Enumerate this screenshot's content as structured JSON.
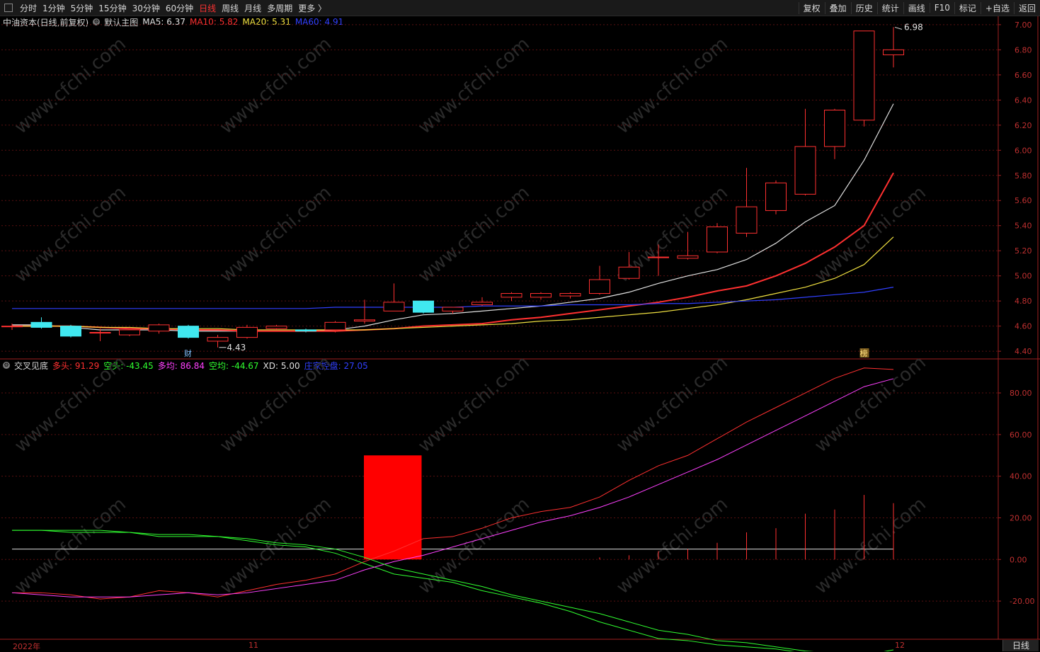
{
  "toolbar": {
    "left_items": [
      "分时",
      "1分钟",
      "5分钟",
      "15分钟",
      "30分钟",
      "60分钟",
      "日线",
      "周线",
      "月线",
      "多周期",
      "更多 〉"
    ],
    "active_item": "日线",
    "right_items": [
      "复权",
      "叠加",
      "历史",
      "统计",
      "画线",
      "F10",
      "标记",
      "+自选",
      "返回"
    ]
  },
  "main_legend": {
    "stock": "中油资本(日线,前复权)",
    "template": "默认主图",
    "ma": [
      {
        "label": "MA5:",
        "value": "6.37",
        "color": "#e0e0e0"
      },
      {
        "label": "MA10:",
        "value": "5.82",
        "color": "#ff3030"
      },
      {
        "label": "MA20:",
        "value": "5.31",
        "color": "#f0e040"
      },
      {
        "label": "MA60:",
        "value": "4.91",
        "color": "#3040ff"
      }
    ]
  },
  "sub_legend": {
    "name": "交叉见底",
    "items": [
      {
        "label": "多头:",
        "value": "91.29",
        "color": "#ff3030"
      },
      {
        "label": "空头:",
        "value": "-43.45",
        "color": "#30ff30"
      },
      {
        "label": "多均:",
        "value": "86.84",
        "color": "#ff40ff"
      },
      {
        "label": "空均:",
        "value": "-44.67",
        "color": "#30ff30"
      },
      {
        "label": "XD:",
        "value": "5.00",
        "color": "#e0e0e0"
      },
      {
        "label": "庄家控盘:",
        "value": "27.05",
        "color": "#3040ff"
      }
    ]
  },
  "annotations": {
    "high": "6.98",
    "low": "4.43",
    "cai": "财",
    "bang": "榜"
  },
  "watermark": "www.cfchi.com",
  "x_axis": {
    "labels": [
      "2022年",
      "11",
      "12"
    ]
  },
  "period_tag": "日线",
  "chart_data": [
    {
      "type": "candlestick",
      "title": "中油资本(日线,前复权)",
      "y_ticks": [
        "7.00",
        "6.80",
        "6.60",
        "6.40",
        "6.20",
        "6.00",
        "5.80",
        "5.60",
        "5.40",
        "5.20",
        "5.00",
        "4.80",
        "4.60",
        "4.40"
      ],
      "ylim": [
        4.35,
        7.05
      ],
      "candles": [
        {
          "o": 4.6,
          "h": 4.62,
          "l": 4.57,
          "c": 4.6
        },
        {
          "o": 4.63,
          "h": 4.67,
          "l": 4.58,
          "c": 4.59
        },
        {
          "o": 4.6,
          "h": 4.61,
          "l": 4.51,
          "c": 4.52
        },
        {
          "o": 4.55,
          "h": 4.58,
          "l": 4.48,
          "c": 4.55
        },
        {
          "o": 4.53,
          "h": 4.57,
          "l": 4.52,
          "c": 4.57
        },
        {
          "o": 4.56,
          "h": 4.62,
          "l": 4.54,
          "c": 4.61
        },
        {
          "o": 4.6,
          "h": 4.61,
          "l": 4.5,
          "c": 4.51
        },
        {
          "o": 4.48,
          "h": 4.53,
          "l": 4.43,
          "c": 4.51
        },
        {
          "o": 4.51,
          "h": 4.61,
          "l": 4.5,
          "c": 4.59
        },
        {
          "o": 4.58,
          "h": 4.61,
          "l": 4.57,
          "c": 4.6
        },
        {
          "o": 4.57,
          "h": 4.58,
          "l": 4.55,
          "c": 4.56
        },
        {
          "o": 4.57,
          "h": 4.64,
          "l": 4.55,
          "c": 4.63
        },
        {
          "o": 4.64,
          "h": 4.81,
          "l": 4.62,
          "c": 4.65
        },
        {
          "o": 4.72,
          "h": 4.94,
          "l": 4.72,
          "c": 4.79
        },
        {
          "o": 4.8,
          "h": 4.8,
          "l": 4.7,
          "c": 4.71
        },
        {
          "o": 4.72,
          "h": 4.75,
          "l": 4.7,
          "c": 4.75
        },
        {
          "o": 4.77,
          "h": 4.83,
          "l": 4.76,
          "c": 4.79
        },
        {
          "o": 4.83,
          "h": 4.87,
          "l": 4.8,
          "c": 4.86
        },
        {
          "o": 4.83,
          "h": 4.87,
          "l": 4.81,
          "c": 4.86
        },
        {
          "o": 4.84,
          "h": 4.87,
          "l": 4.82,
          "c": 4.86
        },
        {
          "o": 4.86,
          "h": 5.08,
          "l": 4.85,
          "c": 4.97
        },
        {
          "o": 4.98,
          "h": 5.19,
          "l": 4.97,
          "c": 5.07
        },
        {
          "o": 5.15,
          "h": 5.25,
          "l": 5.0,
          "c": 5.15
        },
        {
          "o": 5.14,
          "h": 5.35,
          "l": 5.13,
          "c": 5.16
        },
        {
          "o": 5.19,
          "h": 5.42,
          "l": 5.18,
          "c": 5.39
        },
        {
          "o": 5.34,
          "h": 5.86,
          "l": 5.31,
          "c": 5.55
        },
        {
          "o": 5.52,
          "h": 5.76,
          "l": 5.49,
          "c": 5.74
        },
        {
          "o": 5.65,
          "h": 6.33,
          "l": 5.64,
          "c": 6.03
        },
        {
          "o": 6.03,
          "h": 6.33,
          "l": 5.93,
          "c": 6.32
        },
        {
          "o": 6.24,
          "h": 6.95,
          "l": 6.19,
          "c": 6.95
        },
        {
          "o": 6.76,
          "h": 6.98,
          "l": 6.66,
          "c": 6.8
        }
      ],
      "series": [
        {
          "name": "MA5",
          "color": "#e0e0e0",
          "values": [
            4.61,
            4.61,
            4.59,
            4.57,
            4.57,
            4.57,
            4.56,
            4.56,
            4.56,
            4.56,
            4.56,
            4.57,
            4.6,
            4.65,
            4.69,
            4.7,
            4.72,
            4.74,
            4.76,
            4.79,
            4.82,
            4.87,
            4.94,
            5.0,
            5.05,
            5.13,
            5.26,
            5.43,
            5.56,
            5.92,
            6.37
          ]
        },
        {
          "name": "MA10",
          "color": "#ff3030",
          "values": [
            4.6,
            4.6,
            4.6,
            4.59,
            4.58,
            4.58,
            4.57,
            4.57,
            4.56,
            4.56,
            4.56,
            4.56,
            4.57,
            4.58,
            4.6,
            4.61,
            4.62,
            4.65,
            4.67,
            4.7,
            4.73,
            4.76,
            4.79,
            4.83,
            4.88,
            4.92,
            5.0,
            5.1,
            5.23,
            5.4,
            5.82
          ]
        },
        {
          "name": "MA20",
          "color": "#f0e040",
          "values": [
            4.6,
            4.6,
            4.6,
            4.59,
            4.59,
            4.58,
            4.58,
            4.58,
            4.57,
            4.57,
            4.57,
            4.57,
            4.57,
            4.58,
            4.59,
            4.6,
            4.61,
            4.62,
            4.64,
            4.65,
            4.67,
            4.69,
            4.71,
            4.74,
            4.77,
            4.81,
            4.86,
            4.91,
            4.98,
            5.09,
            5.31
          ]
        },
        {
          "name": "MA60",
          "color": "#3040ff",
          "values": [
            4.74,
            4.74,
            4.74,
            4.74,
            4.74,
            4.74,
            4.74,
            4.74,
            4.74,
            4.74,
            4.74,
            4.75,
            4.75,
            4.75,
            4.75,
            4.75,
            4.76,
            4.76,
            4.76,
            4.77,
            4.77,
            4.77,
            4.78,
            4.78,
            4.79,
            4.8,
            4.81,
            4.83,
            4.85,
            4.87,
            4.91
          ]
        }
      ]
    },
    {
      "type": "line",
      "title": "交叉见底",
      "y_ticks": [
        "80.00",
        "60.00",
        "40.00",
        "20.00",
        "0.00",
        "-20.00"
      ],
      "ylim": [
        -38,
        96
      ],
      "series": [
        {
          "name": "多头",
          "color": "#ff3030",
          "values": [
            -16,
            -16,
            -17,
            -19,
            -18,
            -15,
            -16,
            -18,
            -15,
            -12,
            -10,
            -7,
            -1,
            4,
            10,
            11,
            15,
            20,
            23,
            25,
            30,
            38,
            45,
            50,
            58,
            66,
            73,
            80,
            87,
            92,
            91.29
          ]
        },
        {
          "name": "空头",
          "color": "#30ff30",
          "values": [
            14,
            14,
            14,
            14,
            13,
            11,
            11,
            11,
            9,
            7,
            6,
            3,
            -2,
            -7,
            -9,
            -11,
            -15,
            -18,
            -21,
            -25,
            -30,
            -34,
            -38,
            -39,
            -41,
            -42,
            -43,
            -45,
            -46,
            -46,
            -43.45
          ]
        },
        {
          "name": "多均",
          "color": "#ff40ff",
          "values": [
            -16,
            -17,
            -18,
            -18,
            -18,
            -17,
            -16,
            -17,
            -16,
            -14,
            -12,
            -10,
            -5,
            -1,
            2,
            6,
            10,
            14,
            18,
            21,
            25,
            30,
            36,
            42,
            48,
            55,
            62,
            69,
            76,
            83,
            86.84
          ]
        },
        {
          "name": "空均",
          "color": "#30ff30",
          "values": [
            14,
            14,
            13,
            13,
            13,
            12,
            12,
            11,
            10,
            8,
            7,
            5,
            1,
            -4,
            -7,
            -10,
            -13,
            -17,
            -20,
            -23,
            -26,
            -30,
            -34,
            -36,
            -39,
            -40,
            -42,
            -44,
            -45,
            -46,
            -44.67
          ]
        },
        {
          "name": "庄家控盘",
          "color": "#ff3030",
          "type": "bar",
          "values": [
            0,
            0,
            0,
            0,
            0,
            0,
            0,
            0,
            0,
            0,
            0,
            0,
            0,
            0,
            0,
            0,
            0,
            0,
            0,
            0,
            1,
            2,
            4,
            5,
            8,
            13,
            15,
            22,
            24,
            31,
            27.05
          ]
        }
      ],
      "block": {
        "from": 12,
        "to": 13,
        "value": 50,
        "color": "#ff0000"
      },
      "baseline": 5.0
    }
  ]
}
